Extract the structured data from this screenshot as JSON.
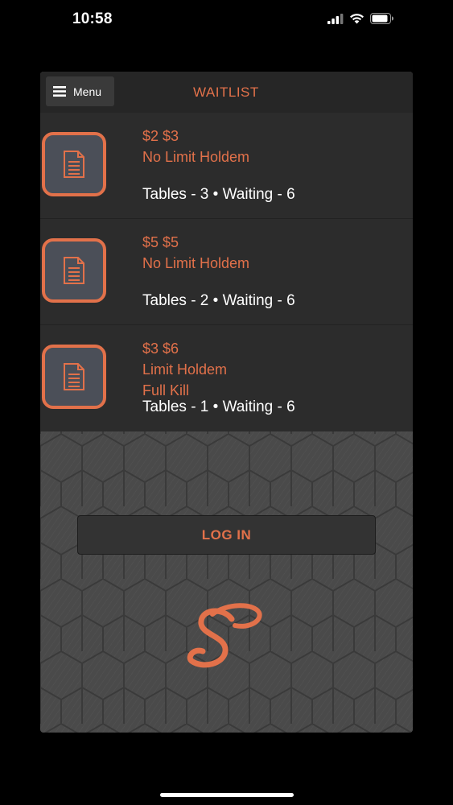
{
  "status_bar": {
    "time": "10:58"
  },
  "header": {
    "menu_label": "Menu",
    "title": "WAITLIST"
  },
  "games": [
    {
      "stakes": "$2 $3",
      "game": "No Limit Holdem",
      "subtitle": "",
      "meta": "Tables - 3 • Waiting - 6"
    },
    {
      "stakes": "$5 $5",
      "game": "No Limit Holdem",
      "subtitle": "",
      "meta": "Tables - 2 • Waiting - 6"
    },
    {
      "stakes": "$3 $6",
      "game": "Limit Holdem",
      "subtitle": "Full Kill",
      "meta": "Tables - 1 • Waiting - 6"
    }
  ],
  "login": {
    "label": "LOG IN"
  },
  "icons": {
    "menu": "hamburger-icon",
    "game": "document-icon",
    "logo": "script-s-logo",
    "signal": "cellular-signal-icon",
    "wifi": "wifi-icon",
    "battery": "battery-icon"
  },
  "colors": {
    "accent": "#e2714a",
    "panel": "#2c2c2c",
    "topbar": "#262626",
    "icon_fill": "#4b4f58",
    "background": "#000000"
  }
}
